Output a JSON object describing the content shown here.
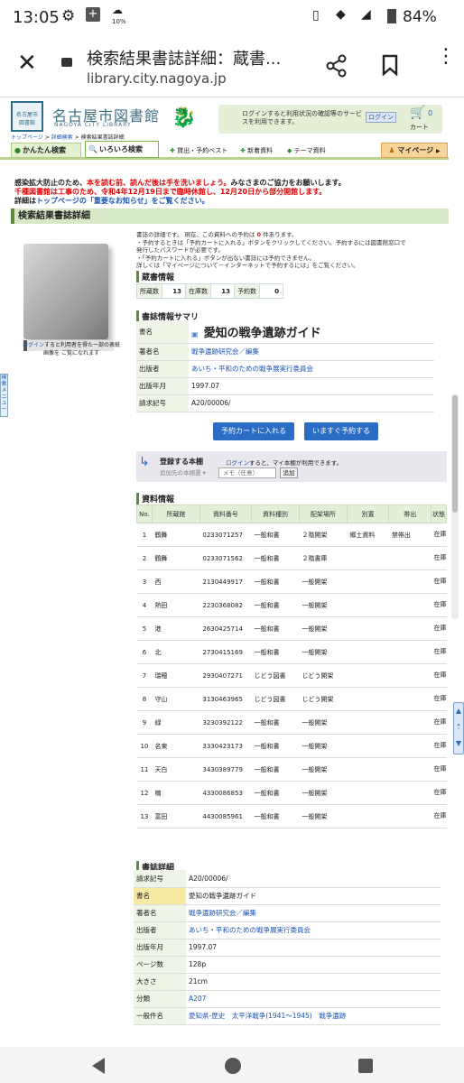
{
  "status": {
    "time": "13:05",
    "battery": "84%",
    "data_label": "10%"
  },
  "browser": {
    "title": "検索結果書誌詳細：蔵書...",
    "url": "library.city.nagoya.jp"
  },
  "header": {
    "logo_ja": "名古屋市図書館",
    "logo_en": "NAGOYA CITY LIBRARY",
    "login_note": "ログインすると利用状況の確認等のサービスを利用できます。",
    "login_button": "ログイン",
    "cart_label": "カート",
    "cart_count": "0"
  },
  "breadcrumb": [
    "トップページ",
    "詳細検索",
    "検索結果書誌詳細"
  ],
  "tabs": {
    "easy": "かんたん検索",
    "various": "いろいろ検索",
    "best": "貸出・予約ベスト",
    "new": "新着資料",
    "theme": "テーマ資料",
    "mypage": "マイページ"
  },
  "notices": {
    "line1_a": "感染拡大防止のため、",
    "line1_b": "本を読む前、読んだ後は手を洗いましょう。",
    "line1_c": "みなさまのご協力をお願いします。",
    "line2": "千種図書館は工事のため、令和4年12月19日まで臨時休館し、12月20日から部分開館します。",
    "line3_a": "詳細は",
    "line3_b": "トップページの「重要なお知らせ」をご覧ください。"
  },
  "page_title": "検索結果書誌詳細",
  "intro": {
    "l1": "書誌の詳細です。 現在、この資料への予約は",
    "count": "0",
    "l1b": "件あります。",
    "l2": "・予約するときは「予約カートに入れる」ボタンをクリックしてください。予約するには図書館窓口で",
    "l3": "発行したパスワードが必要です。",
    "l4": "・「予約カートに入れる」ボタンが出ない書誌には予約できません。",
    "l5": "詳しくは「マイページについて－インターネットで予約するには」をご覧ください。"
  },
  "cover_note": {
    "link": "ログイン",
    "text": "すると利用者を得た一部の表紙画像を ご覧になれます"
  },
  "holdings": {
    "title": "蔵書情報",
    "held_label": "所蔵数",
    "held": "13",
    "instock_label": "在庫数",
    "instock": "13",
    "reserve_label": "予約数",
    "reserve": "0"
  },
  "summary": {
    "title": "書誌情報サマリ",
    "rows": [
      {
        "k": "書名",
        "v": "愛知の戦争遺跡ガイド"
      },
      {
        "k": "著者名",
        "v": "戦争遺跡研究会／編集"
      },
      {
        "k": "出版者",
        "v": "あいち・平和のための戦争展実行委員会"
      },
      {
        "k": "出版年月",
        "v": "1997.07"
      },
      {
        "k": "請求記号",
        "v": "A20/00006/"
      }
    ]
  },
  "buttons": {
    "cart": "予約カートに入れる",
    "now": "いますぐ予約する"
  },
  "shelf": {
    "title": "登録する本棚",
    "login": "ログイン",
    "login_text": "すると、マイ本棚が利用できます。",
    "select": "追加先の本棚選",
    "memo": "メモ（任意）",
    "add": "追加"
  },
  "items": {
    "title": "資料情報",
    "headers": [
      "No.",
      "所蔵館",
      "資料番号",
      "資料種別",
      "配架場所",
      "別置",
      "帯出",
      "状態"
    ],
    "rows": [
      [
        "1",
        "鶴舞",
        "0233071257",
        "一般和書",
        "２階開架",
        "郷土資料",
        "禁帯出",
        "在庫"
      ],
      [
        "2",
        "鶴舞",
        "0233071562",
        "一般和書",
        "２階書庫",
        "",
        "",
        "在庫"
      ],
      [
        "3",
        "西",
        "2130449917",
        "一般和書",
        "一般開架",
        "",
        "",
        "在庫"
      ],
      [
        "4",
        "熱田",
        "2230368082",
        "一般和書",
        "一般開架",
        "",
        "",
        "在庫"
      ],
      [
        "5",
        "港",
        "2630425714",
        "一般和書",
        "一般開架",
        "",
        "",
        "在庫"
      ],
      [
        "6",
        "北",
        "2730415169",
        "一般和書",
        "一般開架",
        "",
        "",
        "在庫"
      ],
      [
        "7",
        "瑞穂",
        "2930407271",
        "じどう図書",
        "じどう開架",
        "",
        "",
        "在庫"
      ],
      [
        "8",
        "守山",
        "3130463965",
        "じどう図書",
        "じどう開架",
        "",
        "",
        "在庫"
      ],
      [
        "9",
        "緑",
        "3230392122",
        "一般和書",
        "一般開架",
        "",
        "",
        "在庫"
      ],
      [
        "10",
        "名東",
        "3330423173",
        "一般和書",
        "一般開架",
        "",
        "",
        "在庫"
      ],
      [
        "11",
        "天白",
        "3430389779",
        "一般和書",
        "一般開架",
        "",
        "",
        "在庫"
      ],
      [
        "12",
        "楠",
        "4330086853",
        "一般和書",
        "一般開架",
        "",
        "",
        "在庫"
      ],
      [
        "13",
        "富田",
        "4430085961",
        "一般和書",
        "一般開架",
        "",
        "",
        "在庫"
      ]
    ]
  },
  "details": {
    "title": "書誌詳細",
    "rows": [
      {
        "k": "請求記号",
        "v": "A20/00006/"
      },
      {
        "k": "書名",
        "v": "愛知の戦争遺跡ガイド"
      },
      {
        "k": "著者名",
        "v": "戦争遺跡研究会／編集"
      },
      {
        "k": "出版者",
        "v": "あいち・平和のための戦争展実行委員会"
      },
      {
        "k": "出版年月",
        "v": "1997.07"
      },
      {
        "k": "ページ数",
        "v": "128p"
      },
      {
        "k": "大きさ",
        "v": "21cm"
      },
      {
        "k": "分類",
        "v": "A207"
      },
      {
        "k": "一般件名",
        "v": "愛知県-歴史　太平洋戦争(1941～1945)　戦争遺跡"
      }
    ]
  },
  "side_tab": "検索メニュー"
}
